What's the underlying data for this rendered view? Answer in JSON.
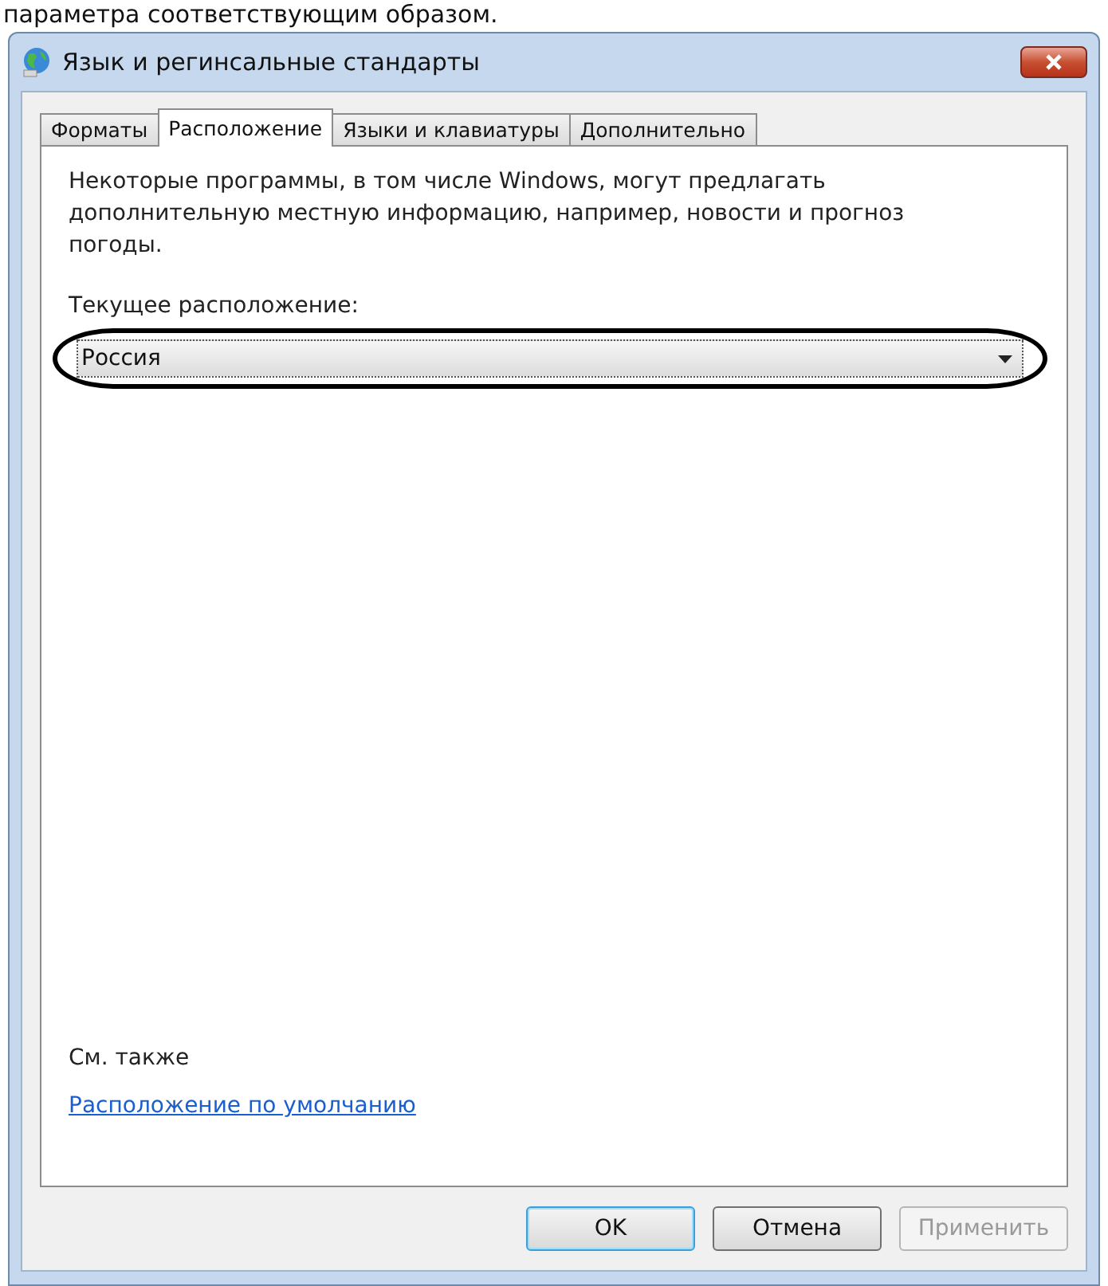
{
  "caption": "параметра соответствующим образом.",
  "window": {
    "title": "Язык и регинсальные стандарты"
  },
  "tabs": [
    {
      "label": "Форматы",
      "selected": false
    },
    {
      "label": "Расположение",
      "selected": true
    },
    {
      "label": "Языки и клавиатуры",
      "selected": false
    },
    {
      "label": "Дополнительно",
      "selected": false
    }
  ],
  "description": "Некоторые программы, в том числе Windows, могут предлагать дополнительную местную информацию, например, новости и прогноз погоды.",
  "location": {
    "label": "Текущее расположение:",
    "value": "Россия",
    "highlighted": true
  },
  "see_also": {
    "heading": "См. также",
    "link": "Расположение по умолчанию"
  },
  "buttons": [
    {
      "label": "OK",
      "default": true,
      "disabled": false
    },
    {
      "label": "Отмена",
      "default": false,
      "disabled": false
    },
    {
      "label": "Применить",
      "default": false,
      "disabled": true
    }
  ]
}
